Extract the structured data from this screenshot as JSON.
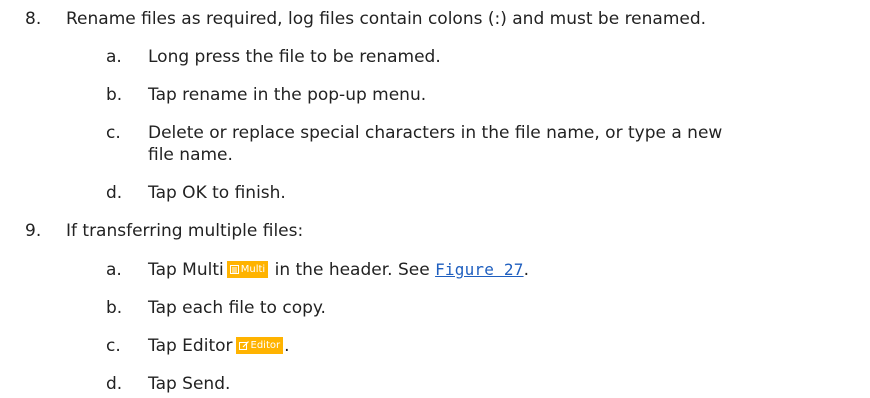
{
  "steps": [
    {
      "number": "8.",
      "text": "Rename files as required, log files contain colons (:) and must be renamed.",
      "substeps": [
        {
          "letter": "a.",
          "text": "Long press the file to be renamed."
        },
        {
          "letter": "b.",
          "text": "Tap rename in the pop-up menu."
        },
        {
          "letter": "c.",
          "text_line1": "Delete or replace special characters in the file name, or type a new",
          "text_line2": "file name."
        },
        {
          "letter": "d.",
          "text": "Tap OK to finish."
        }
      ]
    },
    {
      "number": "9.",
      "text": "If transferring multiple files:",
      "substeps": [
        {
          "letter": "a.",
          "text_before": "Tap Multi",
          "badge_label": "Multi",
          "badge_icon": "list-icon",
          "text_middle": "in the header. See",
          "link_text": "Figure 27",
          "text_after": "."
        },
        {
          "letter": "b.",
          "text": "Tap each file to copy."
        },
        {
          "letter": "c.",
          "text_before": "Tap Editor",
          "badge_label": "Editor",
          "badge_icon": "edit-icon",
          "text_after": "."
        },
        {
          "letter": "d.",
          "text": "Tap Send."
        }
      ]
    }
  ],
  "colors": {
    "badge": "#ffb300",
    "link": "#1f5fbf"
  }
}
